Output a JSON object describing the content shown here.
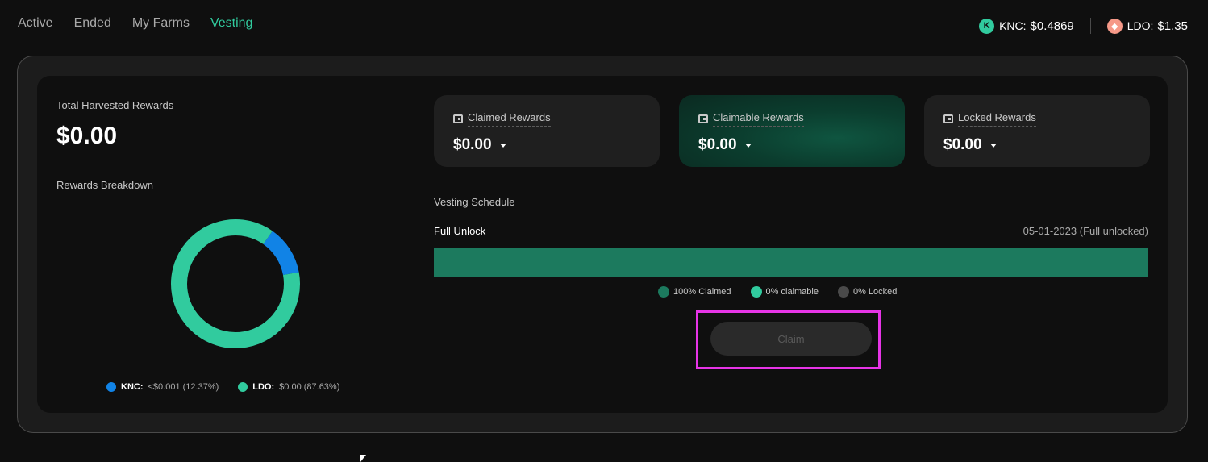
{
  "tabs": [
    {
      "label": "Active"
    },
    {
      "label": "Ended"
    },
    {
      "label": "My Farms"
    },
    {
      "label": "Vesting"
    }
  ],
  "prices": [
    {
      "symbol": "KNC:",
      "value": "$0.4869"
    },
    {
      "symbol": "LDO:",
      "value": "$1.35"
    }
  ],
  "total": {
    "label": "Total Harvested Rewards",
    "value": "$0.00"
  },
  "breakdown": {
    "label": "Rewards Breakdown",
    "items": [
      {
        "symbol": "KNC:",
        "amount": "<$0.001 (12.37%)",
        "share": 12.37,
        "color": "#1183e6"
      },
      {
        "symbol": "LDO:",
        "amount": "$0.00 (87.63%)",
        "share": 87.63,
        "color": "#31cb9e"
      }
    ]
  },
  "cards": [
    {
      "title": "Claimed Rewards",
      "value": "$0.00"
    },
    {
      "title": "Claimable Rewards",
      "value": "$0.00"
    },
    {
      "title": "Locked Rewards",
      "value": "$0.00"
    }
  ],
  "vesting": {
    "label": "Vesting Schedule",
    "unlock_label": "Full Unlock",
    "unlock_date": "05-01-2023 (Full unlocked)",
    "claimed_fraction": 1.0,
    "legend": [
      {
        "text": "100% Claimed",
        "color": "#1c7a5e"
      },
      {
        "text": "0% claimable",
        "color": "#31cb9e"
      },
      {
        "text": "0% Locked",
        "color": "#4a4a4a"
      }
    ],
    "claim_label": "Claim"
  }
}
